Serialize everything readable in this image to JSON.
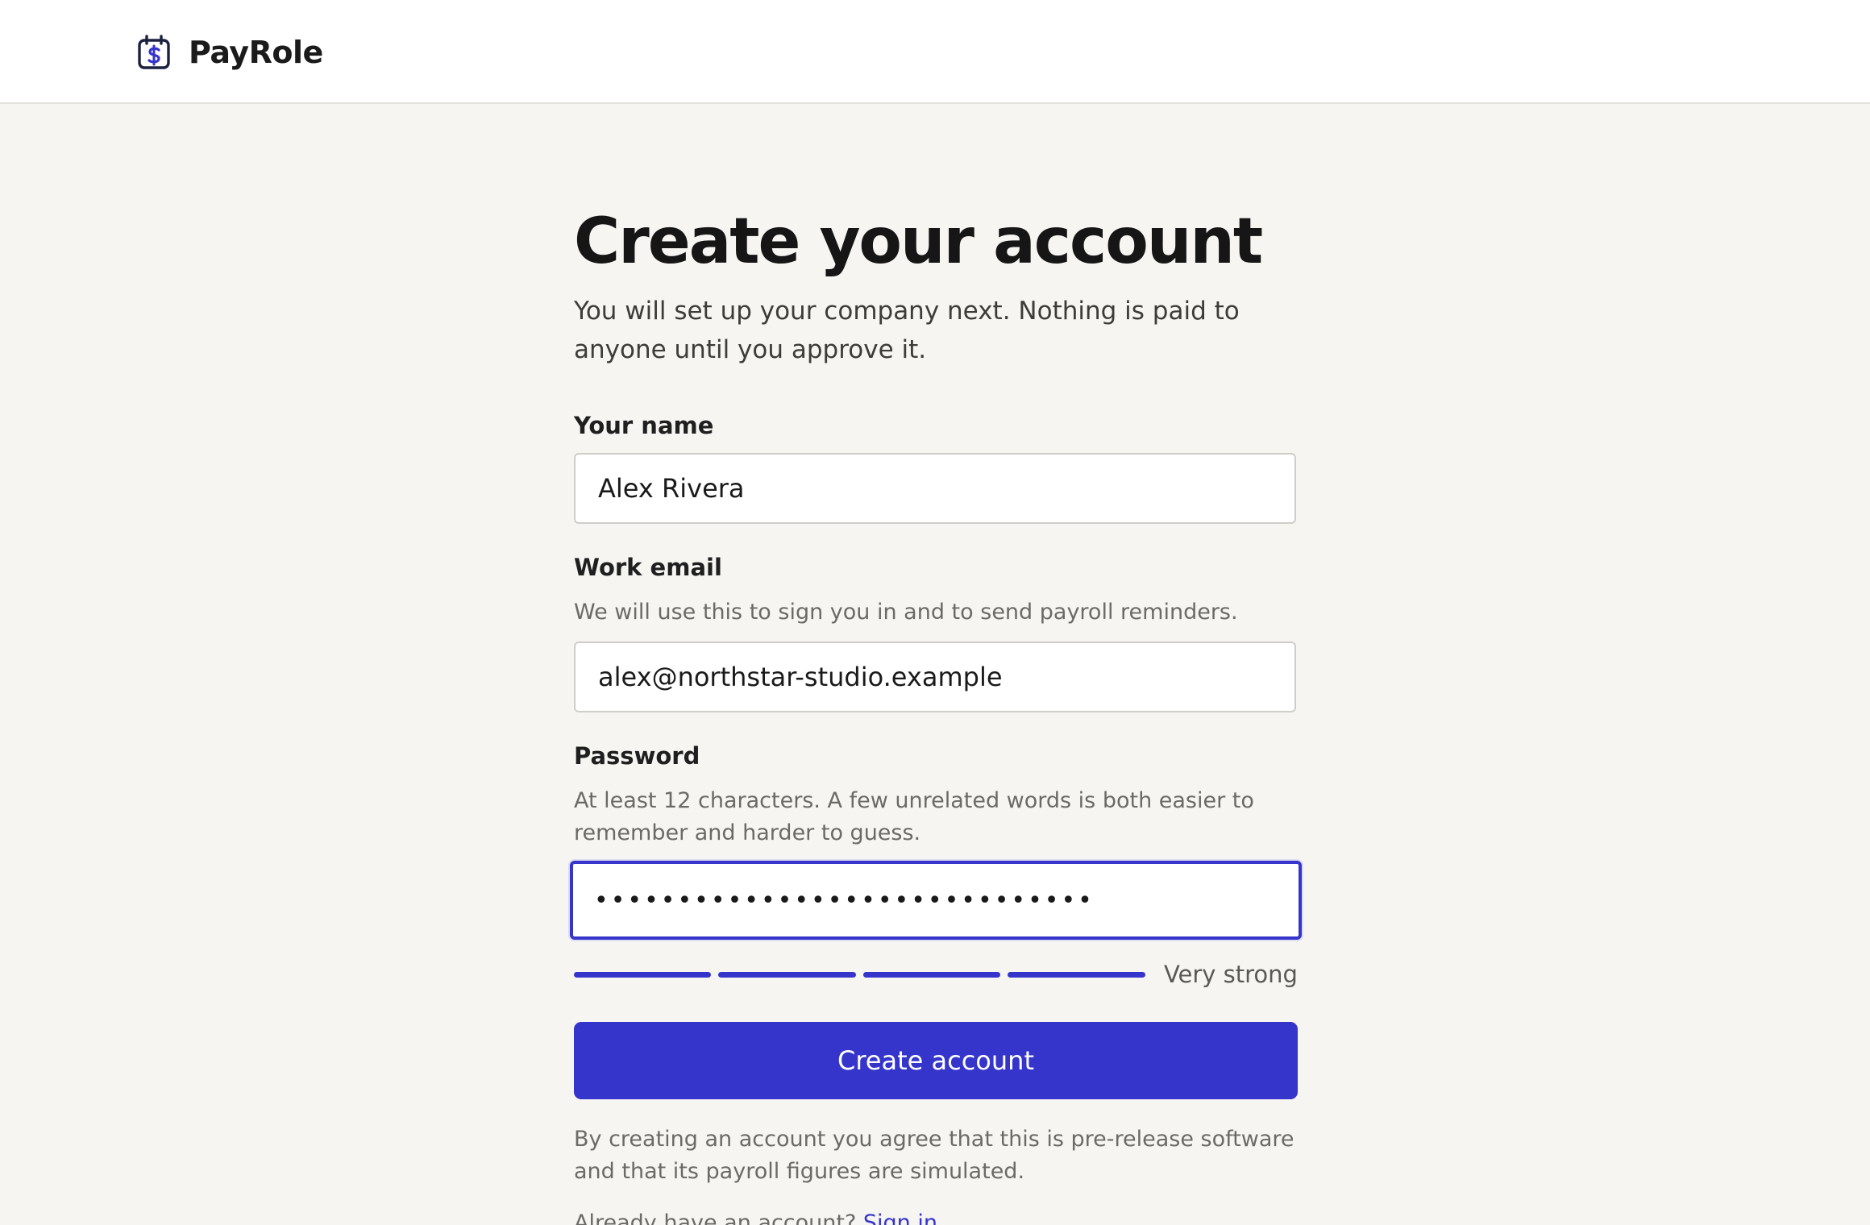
{
  "brand": {
    "name": "PayRole",
    "icon": "calendar-dollar-icon"
  },
  "page": {
    "title": "Create your account",
    "subtitle": "You will set up your company next. Nothing is paid to anyone until you approve it."
  },
  "form": {
    "name": {
      "label": "Your name",
      "value": "Alex Rivera"
    },
    "email": {
      "label": "Work email",
      "hint": "We will use this to sign you in and to send payroll reminders.",
      "value": "alex@northstar-studio.example"
    },
    "password": {
      "label": "Password",
      "hint": "At least 12 characters. A few unrelated words is both easier to remember and harder to guess.",
      "masked_value": "••••••••••••••••••••••••••••••",
      "strength_label": "Very strong",
      "strength_filled_segments": 4,
      "strength_total_segments": 4
    },
    "submit_label": "Create account",
    "terms": "By creating an account you agree that this is pre-release software and that its payroll figures are simulated."
  },
  "footer": {
    "prompt": "Already have an account?",
    "link": "Sign in"
  },
  "colors": {
    "accent": "#3535cc",
    "background": "#f6f5f2",
    "header": "#ffffff"
  }
}
